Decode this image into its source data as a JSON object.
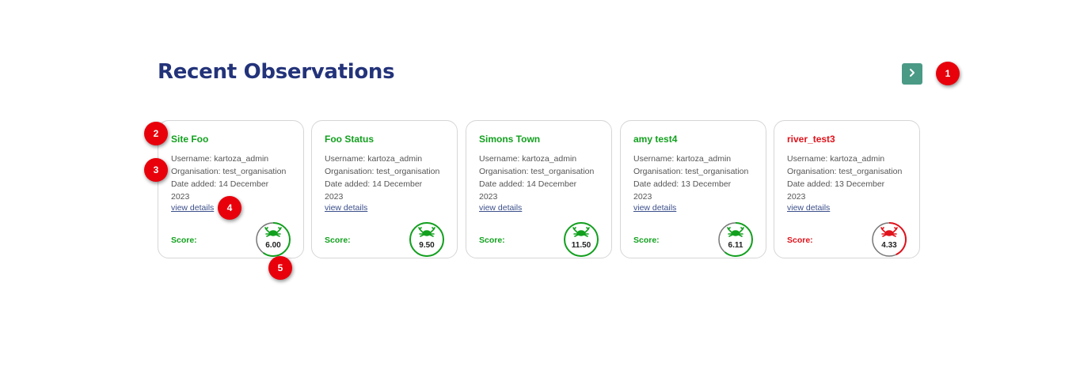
{
  "page": {
    "title": "Recent Observations",
    "next_button_icon": "chevron-right-icon"
  },
  "labels": {
    "username_prefix": "Username:",
    "organisation_prefix": "Organisation:",
    "date_prefix": "Date added:",
    "view_details": "view details",
    "score": "Score:"
  },
  "colors": {
    "title": "#23337a",
    "good": "#12a01e",
    "bad": "#e0121b",
    "next_button": "#4a9a86",
    "marker": "#e8000b"
  },
  "observations": [
    {
      "site": "Site Foo",
      "username": "kartoza_admin",
      "organisation": "test_organisation",
      "date_line1": "14 December",
      "date_line2": "2023",
      "score": "6.00",
      "status": "good",
      "score_fraction": 0.6
    },
    {
      "site": "Foo Status",
      "username": "kartoza_admin",
      "organisation": "test_organisation",
      "date_line1": "14 December",
      "date_line2": "2023",
      "score": "9.50",
      "status": "good",
      "score_fraction": 1.0
    },
    {
      "site": "Simons Town",
      "username": "kartoza_admin",
      "organisation": "test_organisation",
      "date_line1": "14 December",
      "date_line2": "2023",
      "score": "11.50",
      "status": "good",
      "score_fraction": 1.0
    },
    {
      "site": "amy test4",
      "username": "kartoza_admin",
      "organisation": "test_organisation",
      "date_line1": "13 December",
      "date_line2": "2023",
      "score": "6.11",
      "status": "good",
      "score_fraction": 0.61
    },
    {
      "site": "river_test3",
      "username": "kartoza_admin",
      "organisation": "test_organisation",
      "date_line1": "13 December",
      "date_line2": "2023",
      "score": "4.33",
      "status": "bad",
      "score_fraction": 0.43
    }
  ],
  "markers": [
    "1",
    "2",
    "3",
    "4",
    "5"
  ]
}
